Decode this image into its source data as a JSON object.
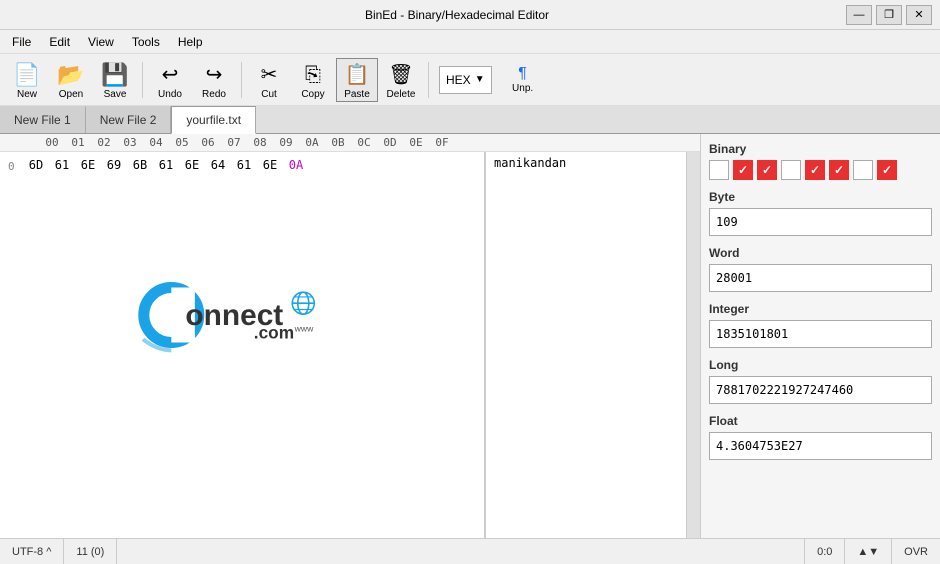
{
  "titleBar": {
    "title": "BinEd - Binary/Hexadecimal Editor",
    "minimizeLabel": "—",
    "restoreLabel": "❐",
    "closeLabel": "✕"
  },
  "menuBar": {
    "items": [
      "File",
      "Edit",
      "View",
      "Tools",
      "Help"
    ]
  },
  "toolbar": {
    "buttons": [
      {
        "id": "new",
        "icon": "📄",
        "label": "New"
      },
      {
        "id": "open",
        "icon": "📂",
        "label": "Open"
      },
      {
        "id": "save",
        "icon": "💾",
        "label": "Save"
      },
      {
        "id": "undo",
        "icon": "↩",
        "label": "Undo"
      },
      {
        "id": "redo",
        "icon": "↪",
        "label": "Redo"
      },
      {
        "id": "cut",
        "icon": "✂",
        "label": "Cut"
      },
      {
        "id": "copy",
        "icon": "⎘",
        "label": "Copy"
      },
      {
        "id": "paste",
        "icon": "📋",
        "label": "Paste"
      },
      {
        "id": "delete",
        "icon": "🗑",
        "label": "Delete"
      }
    ],
    "hexDropdown": "HEX",
    "unpLabel": "Unp."
  },
  "tabs": [
    {
      "id": "tab1",
      "label": "New File 1",
      "active": false
    },
    {
      "id": "tab2",
      "label": "New File 2",
      "active": false
    },
    {
      "id": "tab3",
      "label": "yourfile.txt",
      "active": true
    }
  ],
  "hexEditor": {
    "columnHeaders": [
      "00",
      "01",
      "02",
      "03",
      "04",
      "05",
      "06",
      "07",
      "08",
      "09",
      "0A",
      "0B",
      "0C",
      "0D",
      "0E",
      "0F"
    ],
    "rows": [
      {
        "addr": "0",
        "bytes": [
          "6D",
          "61",
          "6E",
          "69",
          "6B",
          "61",
          "6E",
          "64",
          "61",
          "6E",
          "0A"
        ],
        "specialBytes": [
          "0A"
        ],
        "text": "manikandan"
      }
    ]
  },
  "rightPanel": {
    "binaryLabel": "Binary",
    "binaryBits": [
      {
        "checked": false
      },
      {
        "checked": true
      },
      {
        "checked": true
      },
      {
        "checked": false
      },
      {
        "checked": true
      },
      {
        "checked": true
      },
      {
        "checked": false
      },
      {
        "checked": true
      }
    ],
    "byteLabel": "Byte",
    "byteValue": "109",
    "wordLabel": "Word",
    "wordValue": "28001",
    "integerLabel": "Integer",
    "integerValue": "1835101801",
    "longLabel": "Long",
    "longValue": "7881702221927247460",
    "floatLabel": "Float",
    "floatValue": "4.3604753E27"
  },
  "statusBar": {
    "encoding": "UTF-8 ^",
    "position": "11 (0)",
    "cursor": "0:0",
    "mode": "OVR",
    "scrollUpIcon": "▲",
    "scrollDownIcon": "▼"
  },
  "logo": {
    "text": "Connect.com",
    "subText": "www"
  }
}
